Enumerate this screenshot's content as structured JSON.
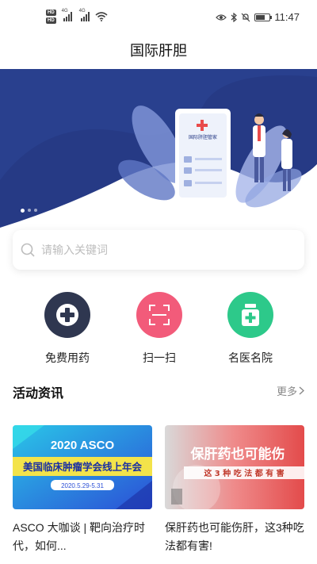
{
  "status_bar": {
    "badges": [
      "HD",
      "HD"
    ],
    "network": [
      "4G",
      "4G"
    ],
    "time": "11:47"
  },
  "header": {
    "title": "国际肝胆"
  },
  "banner": {
    "card_caption": "国际肝胆管家",
    "slides": 3,
    "active_slide": 1,
    "colors": {
      "navy": "#263a85",
      "accent": "#e94b4b"
    }
  },
  "search": {
    "placeholder": "请输入关键词"
  },
  "quick_actions": [
    {
      "label": "免费用药",
      "icon": "plus-circle-icon",
      "color": "#2f3750"
    },
    {
      "label": "扫一扫",
      "icon": "scan-icon",
      "color": "#f25b7a"
    },
    {
      "label": "名医名院",
      "icon": "medicine-bottle-icon",
      "color": "#2dc98a"
    }
  ],
  "news": {
    "section_title": "活动资讯",
    "more_label": "更多",
    "items": [
      {
        "title": "ASCO 大咖谈 | 靶向治疗时代，如何...",
        "thumb_heading": "2020 ASCO",
        "thumb_sub": "美国临床肿瘤学会线上年会",
        "thumb_date": "2020.5.29-5.31"
      },
      {
        "title": "保肝药也可能伤肝，这3种吃法都有害!",
        "thumb_heading": "保肝药也可能伤",
        "thumb_sub": "这 3 种 吃 法 都 有 害"
      }
    ]
  }
}
